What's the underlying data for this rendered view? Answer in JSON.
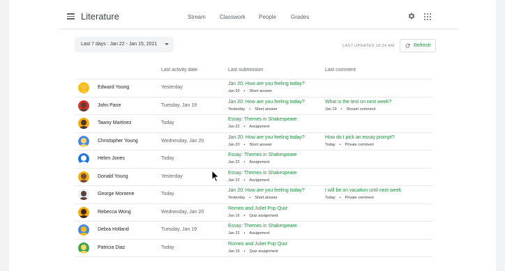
{
  "header": {
    "title": "Literature",
    "tabs": [
      "Stream",
      "Classwork",
      "People",
      "Grades"
    ]
  },
  "toolbar": {
    "date_range": "Last 7 days :  Jan 22 - Jan 15, 2021",
    "last_updated": "LAST UPDATED 10:24 AM",
    "refresh_label": "Refresh"
  },
  "table": {
    "columns": [
      "Last activity date",
      "Last submission",
      "Last comment"
    ],
    "rows": [
      {
        "name": "Edward Young",
        "activity": "Yesterday",
        "sub_title": "Jan 20: How are you feeling today?",
        "sub_date": "Jan 20",
        "sub_type": "Short answer",
        "cm_title": "",
        "cm_date": "",
        "cm_type": "",
        "avatar_bg": "#fbbc04",
        "avatar_fg": "#f6c342"
      },
      {
        "name": "John Pane",
        "activity": "Tuesday, Jan 19",
        "sub_title": "Jan 20: How are you feeling today?",
        "sub_date": "Yesterday",
        "sub_type": "Short answer",
        "cm_title": "What is the test on next week?",
        "cm_date": "Jan 19",
        "cm_type": "Stream comment",
        "avatar_bg": "#d93025",
        "avatar_fg": "#5d4037"
      },
      {
        "name": "Tawny Martinez",
        "activity": "Today",
        "sub_title": "Essay: Themes in Shakespeare",
        "sub_date": "Jan 22",
        "sub_type": "Assignment",
        "cm_title": "",
        "cm_date": "",
        "cm_type": "",
        "avatar_bg": "#f9ab00",
        "avatar_fg": "#4e342e"
      },
      {
        "name": "Christopher Young",
        "activity": "Wednesday, Jan 20",
        "sub_title": "Jan 20: How are you feeling today?",
        "sub_date": "Jan 20",
        "sub_type": "Short answer",
        "cm_title": "How do I pick an essay prompt?",
        "cm_date": "Today",
        "cm_type": "Private comment",
        "avatar_bg": "#4285f4",
        "avatar_fg": "#fdd663"
      },
      {
        "name": "Helen Jones",
        "activity": "Today",
        "sub_title": "Essay: Themes in Shakespeare",
        "sub_date": "Jan 22",
        "sub_type": "Assignment",
        "cm_title": "",
        "cm_date": "",
        "cm_type": "",
        "avatar_bg": "#1a73e8",
        "avatar_fg": "#ffffff"
      },
      {
        "name": "Donald Young",
        "activity": "Yesterday",
        "sub_title": "Essay: Themes in Shakespeare",
        "sub_date": "Jan 22",
        "sub_type": "Assignment",
        "cm_title": "",
        "cm_date": "",
        "cm_type": "",
        "avatar_bg": "#f9ab00",
        "avatar_fg": "#6d4c41"
      },
      {
        "name": "George Montene",
        "activity": "Today",
        "sub_title": "Jan 20: How are you feeling today?",
        "sub_date": "Yesterday",
        "sub_type": "Short answer",
        "cm_title": "I will be on vacation until next week",
        "cm_date": "Today",
        "cm_type": "Private comment",
        "avatar_bg": "#e8f0fe",
        "avatar_fg": "#5d4037"
      },
      {
        "name": "Rebecca Wong",
        "activity": "Wednesday, Jan 20",
        "sub_title": "Romeo and Juliet Pop Quiz",
        "sub_date": "Jan 16",
        "sub_type": "Quiz assignment",
        "cm_title": "",
        "cm_date": "",
        "cm_type": "",
        "avatar_bg": "#f9ab00",
        "avatar_fg": "#3e2723"
      },
      {
        "name": "Debra Holland",
        "activity": "Tuesday, Jan 19",
        "sub_title": "Essay: Themes in Shakespeare",
        "sub_date": "Jan 22",
        "sub_type": "Assignment",
        "cm_title": "",
        "cm_date": "",
        "cm_type": "",
        "avatar_bg": "#4285f4",
        "avatar_fg": "#fbbc04"
      },
      {
        "name": "Patricia Diaz",
        "activity": "Today",
        "sub_title": "Romeo and Juliet Pop Quiz",
        "sub_date": "Jan 16",
        "sub_type": "Quiz assignment",
        "cm_title": "",
        "cm_date": "",
        "cm_type": "",
        "avatar_bg": "#34a853",
        "avatar_fg": "#fdd663"
      }
    ]
  },
  "colors": {
    "accent_green": "#1e8e3e",
    "divider": "#e8eaed"
  },
  "icons": {
    "menu": "menu-icon",
    "settings": "gear-icon",
    "apps": "apps-grid-icon",
    "refresh": "refresh-icon",
    "dropdown": "caret-down-icon"
  }
}
